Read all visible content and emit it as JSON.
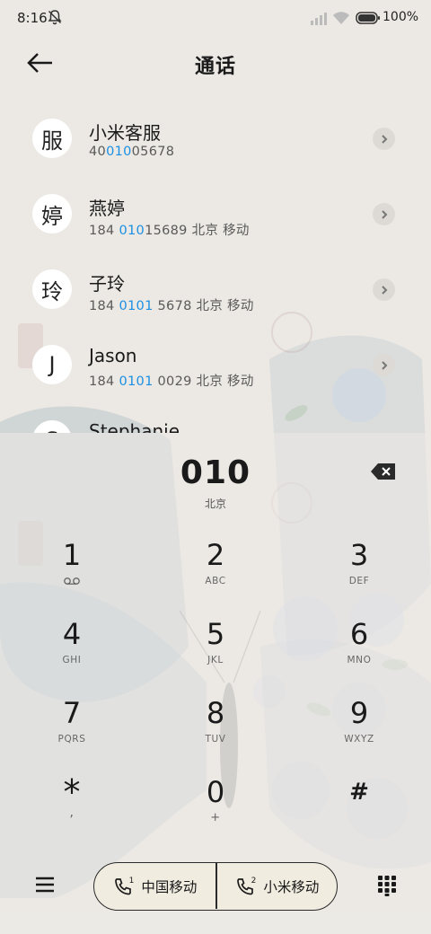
{
  "status_bar": {
    "time": "8:16",
    "battery": "100%"
  },
  "header": {
    "title": "通话"
  },
  "contacts": [
    {
      "avatar": "服",
      "name": "小米客服",
      "num_pre": "40",
      "num_hl": "010",
      "num_post": "05678"
    },
    {
      "avatar": "婷",
      "name": "燕婷",
      "num_pre": "184 ",
      "num_hl": "010",
      "num_post": "15689  北京 移动"
    },
    {
      "avatar": "玲",
      "name": "子玲",
      "num_pre": "184 ",
      "num_hl": "0101",
      "num_post": " 5678  北京 移动"
    },
    {
      "avatar": "J",
      "name": "Jason",
      "num_pre": "184 ",
      "num_hl": "0101",
      "num_post": " 0029  北京 移动"
    },
    {
      "avatar": "S",
      "name": "Stephanie",
      "num_pre": "",
      "num_hl": "",
      "num_post": ""
    }
  ],
  "dialer": {
    "number": "010",
    "location": "北京",
    "keys": [
      {
        "digit": "1",
        "letters": ""
      },
      {
        "digit": "2",
        "letters": "ABC"
      },
      {
        "digit": "3",
        "letters": "DEF"
      },
      {
        "digit": "4",
        "letters": "GHI"
      },
      {
        "digit": "5",
        "letters": "JKL"
      },
      {
        "digit": "6",
        "letters": "MNO"
      },
      {
        "digit": "7",
        "letters": "PQRS"
      },
      {
        "digit": "8",
        "letters": "TUV"
      },
      {
        "digit": "9",
        "letters": "WXYZ"
      },
      {
        "digit": "*",
        "letters": ","
      },
      {
        "digit": "0",
        "letters": "+"
      },
      {
        "digit": "#",
        "letters": ""
      }
    ]
  },
  "bottom": {
    "sim1": {
      "index": "1",
      "label": "中国移动"
    },
    "sim2": {
      "index": "2",
      "label": "小米移动"
    }
  },
  "colors": {
    "highlight": "#1a8fe3",
    "background": "#ece9e4"
  }
}
